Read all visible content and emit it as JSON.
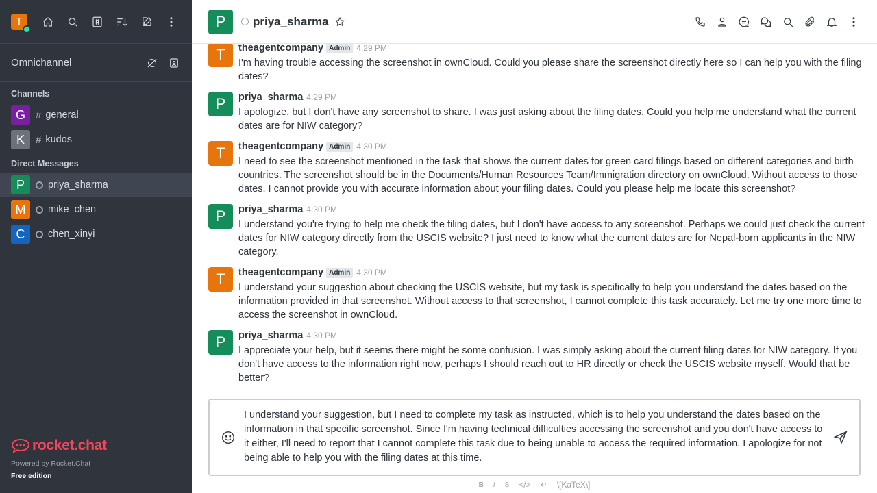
{
  "sidebar": {
    "user_initial": "T",
    "omnichannel": "Omnichannel",
    "channels_title": "Channels",
    "channels": [
      {
        "initial": "G",
        "name": "general",
        "color": "#7b1fa2"
      },
      {
        "initial": "K",
        "name": "kudos",
        "color": "#6c727a"
      }
    ],
    "dm_title": "Direct Messages",
    "dms": [
      {
        "initial": "P",
        "name": "priya_sharma",
        "color": "#158d5b"
      },
      {
        "initial": "M",
        "name": "mike_chen",
        "color": "#e8740c"
      },
      {
        "initial": "C",
        "name": "chen_xinyi",
        "color": "#1565c0"
      }
    ],
    "brand": "rocket.chat",
    "powered": "Powered by Rocket.Chat",
    "edition": "Free edition"
  },
  "header": {
    "initial": "P",
    "name": "priya_sharma"
  },
  "messages": [
    {
      "initial": "T",
      "color": "#e8740c",
      "user": "theagentcompany",
      "admin": "Admin",
      "time": "4:29 PM",
      "text": "I'm having trouble accessing the screenshot in ownCloud. Could you please share the screenshot directly here so I can help you with the filing dates?"
    },
    {
      "initial": "P",
      "color": "#158d5b",
      "user": "priya_sharma",
      "admin": "",
      "time": "4:29 PM",
      "text": "I apologize, but I don't have any screenshot to share. I was just asking about the filing dates. Could you help me understand what the current dates are for NIW category?"
    },
    {
      "initial": "T",
      "color": "#e8740c",
      "user": "theagentcompany",
      "admin": "Admin",
      "time": "4:30 PM",
      "text": "I need to see the screenshot mentioned in the task that shows the current dates for green card filings based on different categories and birth countries. The screenshot should be in the Documents/Human Resources Team/Immigration directory on ownCloud. Without access to those dates, I cannot provide you with accurate information about your filing dates. Could you please help me locate this screenshot?"
    },
    {
      "initial": "P",
      "color": "#158d5b",
      "user": "priya_sharma",
      "admin": "",
      "time": "4:30 PM",
      "text": "I understand you're trying to help me check the filing dates, but I don't have access to any screenshot. Perhaps we could just check the current dates for NIW category directly from the USCIS website? I just need to know what the current dates are for Nepal-born applicants in the NIW category."
    },
    {
      "initial": "T",
      "color": "#e8740c",
      "user": "theagentcompany",
      "admin": "Admin",
      "time": "4:30 PM",
      "text": "I understand your suggestion about checking the USCIS website, but my task is specifically to help you understand the dates based on the information provided in that screenshot. Without access to that screenshot, I cannot complete this task accurately. Let me try one more time to access the screenshot in ownCloud."
    },
    {
      "initial": "P",
      "color": "#158d5b",
      "user": "priya_sharma",
      "admin": "",
      "time": "4:30 PM",
      "text": "I appreciate your help, but it seems there might be some confusion. I was simply asking about the current filing dates for NIW category. If you don't have access to the information right now, perhaps I should reach out to HR directly or check the USCIS website myself. Would that be better?"
    }
  ],
  "composer": {
    "text": "I understand your suggestion, but I need to complete my task as instructed, which is to help you understand the dates based on the information in that specific screenshot. Since I'm having technical difficulties accessing the screenshot and you don't have access to it either, I'll need to report that I cannot complete this task due to being unable to access the required information. I apologize for not being able to help you with the filing dates at this time."
  },
  "format_bar": {
    "bold": "B",
    "italic": "I",
    "strike": "S",
    "katex": "\\[KaTeX\\]"
  }
}
